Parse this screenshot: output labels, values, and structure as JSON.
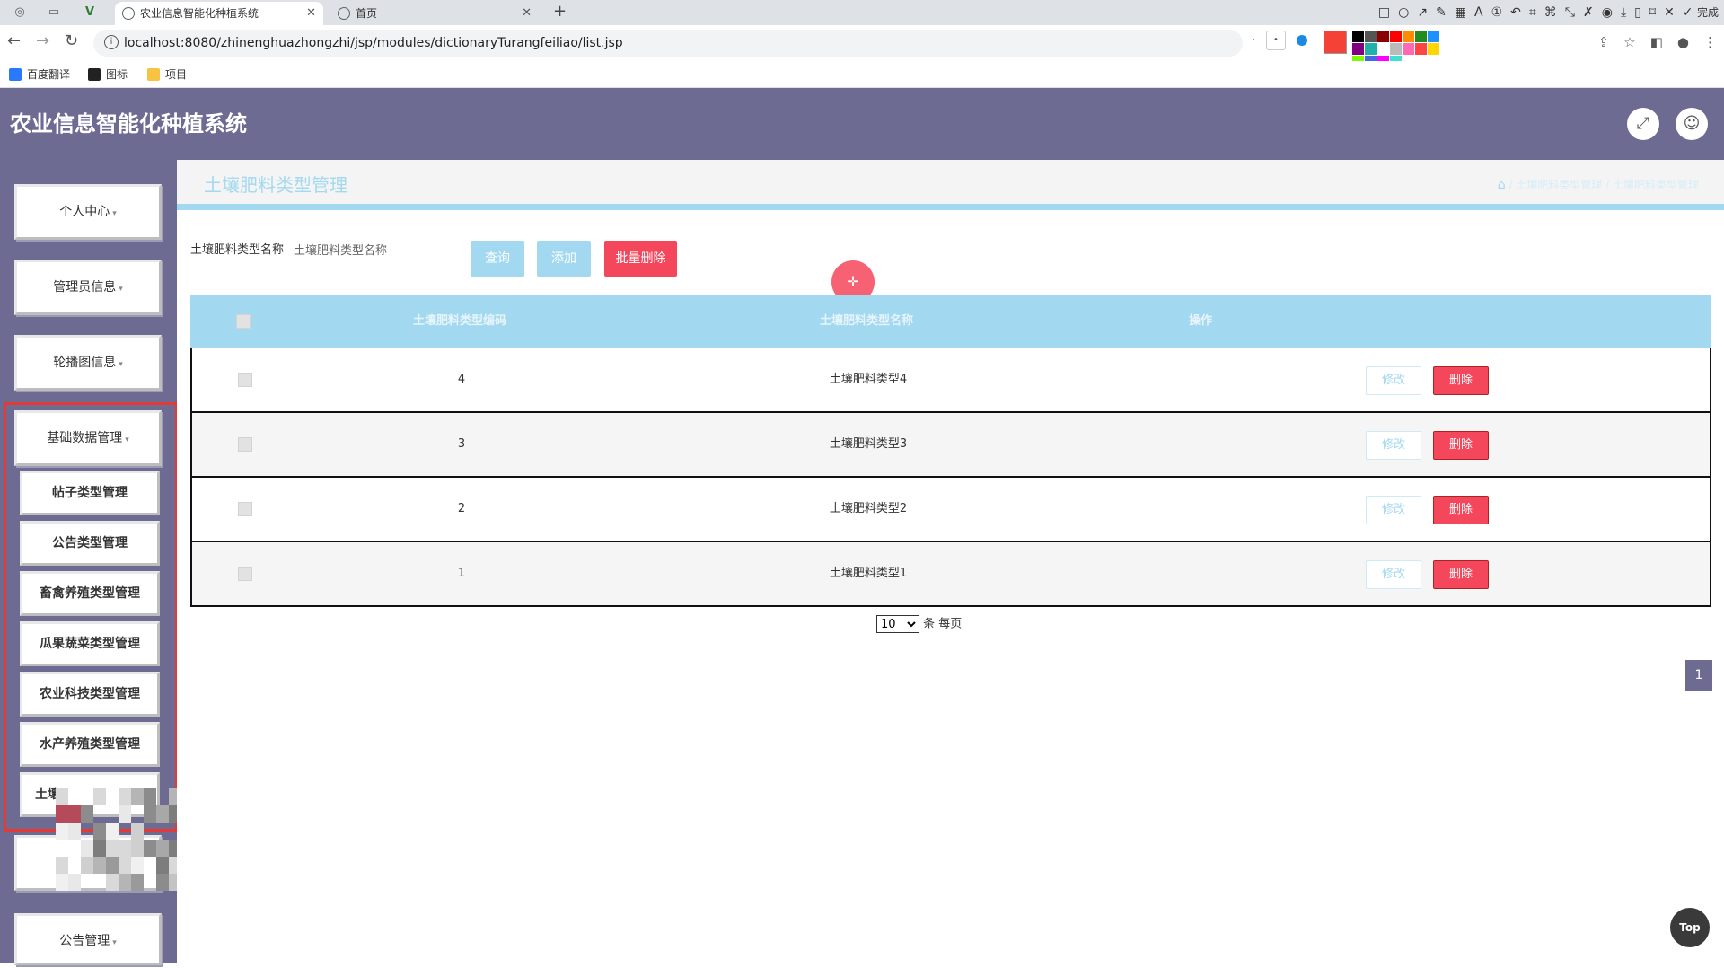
{
  "browser": {
    "tabs": [
      {
        "title": "农业信息智能化种植系统",
        "active": true
      },
      {
        "title": "首页",
        "active": false
      }
    ],
    "url": "localhost:8080/zhinenghuazhongzhi/jsp/modules/dictionaryTurangfeiliao/list.jsp",
    "done_label": "完成",
    "bookmarks": [
      "百度翻译",
      "图标",
      "项目"
    ],
    "palette_colors": [
      "#000000",
      "#555555",
      "#8b0000",
      "#ff0000",
      "#ff8c00",
      "#228b22",
      "#1e90ff",
      "#800080",
      "#20b2aa",
      "#ffffff",
      "#bbbbbb",
      "#ff69b4",
      "#ff4444",
      "#ffd700",
      "#7cfc00",
      "#4169e1",
      "#ff00ff",
      "#40e0d0"
    ],
    "selected_color": "#f44336"
  },
  "app": {
    "title": "农业信息智能化种植系统"
  },
  "sidebar": {
    "menus": [
      {
        "label": "个人中心"
      },
      {
        "label": "管理员信息"
      },
      {
        "label": "轮播图信息"
      },
      {
        "label": "基础数据管理"
      }
    ],
    "submenus": [
      {
        "label": "帖子类型管理"
      },
      {
        "label": "公告类型管理"
      },
      {
        "label": "畜禽养殖类型管理"
      },
      {
        "label": "瓜果蔬菜类型管理"
      },
      {
        "label": "农业科技类型管理"
      },
      {
        "label": "水产养殖类型管理"
      },
      {
        "label": "土壤"
      }
    ],
    "bottom_menu": {
      "label": "公告管理"
    }
  },
  "page": {
    "title": "土壤肥料类型管理",
    "breadcrumb": [
      "土壤肥料类型管理",
      "土壤肥料类型管理"
    ],
    "search": {
      "label": "土壤肥料类型名称",
      "placeholder": "土壤肥料类型名称"
    },
    "buttons": {
      "query": "查询",
      "add": "添加",
      "batch_delete": "批量删除"
    },
    "table": {
      "columns": [
        "土壤肥料类型编码",
        "土壤肥料类型名称",
        "操作"
      ],
      "rows": [
        {
          "code": "4",
          "name": "土壤肥料类型4"
        },
        {
          "code": "3",
          "name": "土壤肥料类型3"
        },
        {
          "code": "2",
          "name": "土壤肥料类型2"
        },
        {
          "code": "1",
          "name": "土壤肥料类型1"
        }
      ],
      "edit_label": "修改",
      "delete_label": "删除"
    },
    "pagination": {
      "page_size": "10",
      "per_page_label": "条 每页",
      "current_page": "1"
    },
    "top_label": "Top"
  }
}
